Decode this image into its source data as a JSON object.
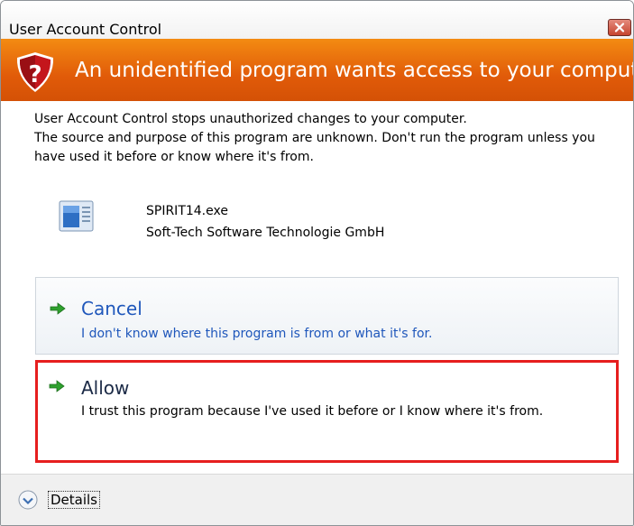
{
  "window": {
    "title": "User Account Control",
    "close_icon": "close-icon"
  },
  "banner": {
    "icon": "shield-warning-icon",
    "heading": "An unidentified program wants access to your computer"
  },
  "body": {
    "line1": "User Account Control stops unauthorized changes to your computer.",
    "line2": "The source and purpose of this program are unknown.  Don't run the program unless you have used it before or know where it's from."
  },
  "program": {
    "icon": "application-icon",
    "name": "SPIRIT14.exe",
    "publisher": "Soft-Tech Software Technologie GmbH"
  },
  "options": [
    {
      "icon": "green-arrow-icon",
      "title": "Cancel",
      "description": "I don't know where this program is from or what it's for."
    },
    {
      "icon": "green-arrow-icon",
      "title": "Allow",
      "description": "I trust this program because I've used it before or I know where it's from."
    }
  ],
  "footer": {
    "icon": "chevron-down-circle-icon",
    "details_label": "Details"
  },
  "colors": {
    "banner": "#e86e0a",
    "link_blue": "#1f57bb",
    "highlight_border": "#e61e1e"
  }
}
